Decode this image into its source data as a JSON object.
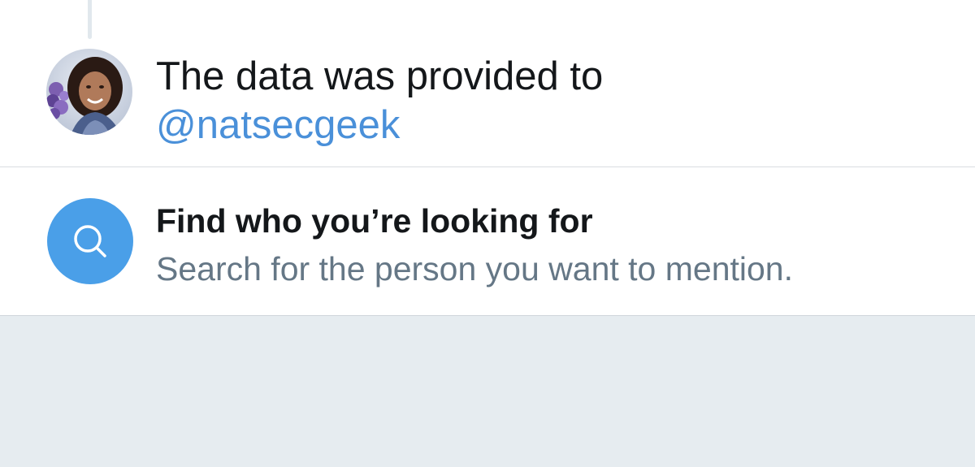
{
  "compose": {
    "text": "The data was provided to",
    "mention": "@natsecgeek"
  },
  "suggestion": {
    "title": "Find who you’re looking for",
    "subtitle": "Search for the person you want to mention.",
    "icon": "search-icon"
  },
  "colors": {
    "mention": "#4a90d9",
    "search_circle": "#4a9fe8",
    "background": "#e6ecf0"
  }
}
